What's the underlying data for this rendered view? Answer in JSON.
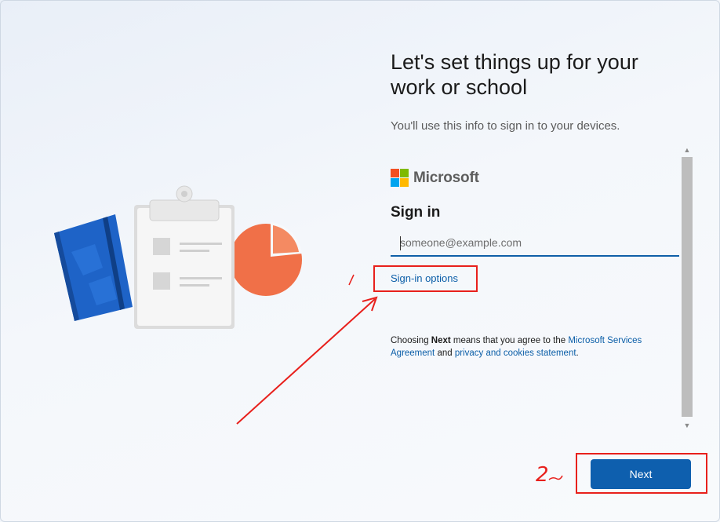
{
  "header": {
    "title": "Let's set things up for your work or school",
    "subtitle": "You'll use this info to sign in to your devices."
  },
  "signin": {
    "brand": "Microsoft",
    "heading": "Sign in",
    "email_placeholder": "someone@example.com",
    "email_value": "",
    "options_link": "Sign-in options",
    "agreement": {
      "prefix": "Choosing ",
      "bold": "Next",
      "middle": " means that you agree to the ",
      "link1": "Microsoft Services Agreement",
      "and": " and ",
      "link2": "privacy and cookies statement",
      "suffix": "."
    }
  },
  "footer": {
    "next_label": "Next"
  },
  "annotations": {
    "step_label": "2"
  },
  "colors": {
    "accent": "#0e5fae",
    "link": "#0b5ea8",
    "annotation": "#e8201c",
    "ms_red": "#f25022",
    "ms_green": "#7fba00",
    "ms_blue": "#00a4ef",
    "ms_yellow": "#ffb900"
  }
}
